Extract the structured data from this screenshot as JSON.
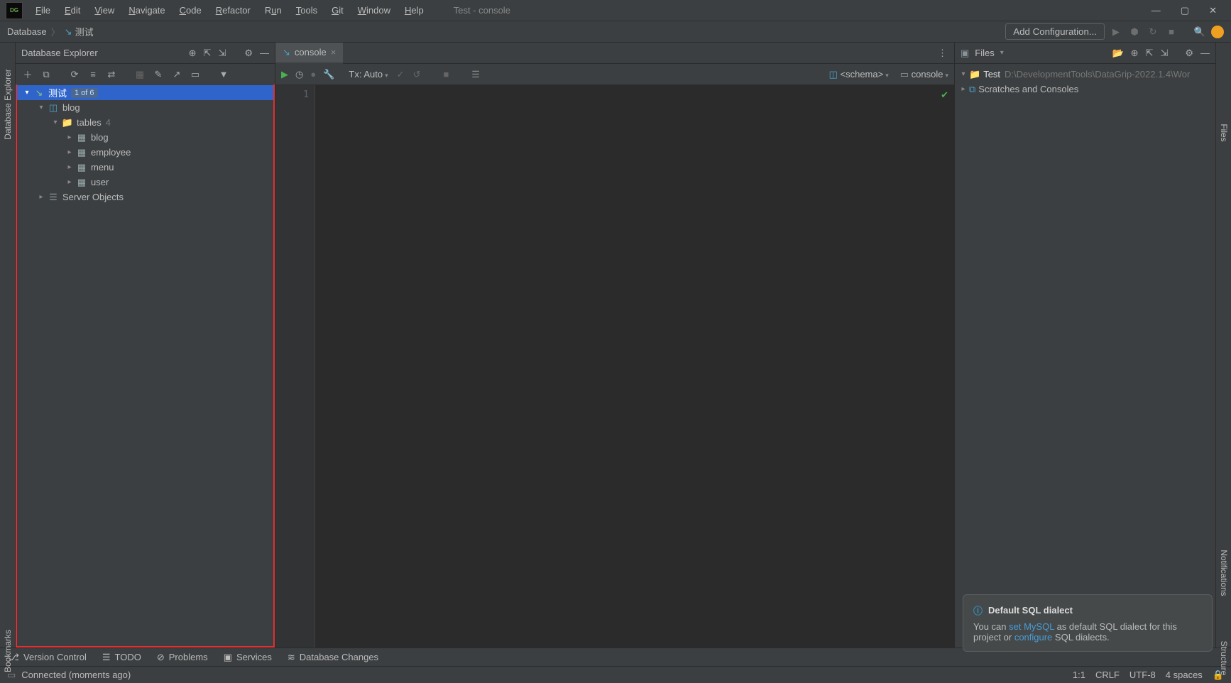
{
  "window": {
    "title": "Test - console",
    "menus": [
      "File",
      "Edit",
      "View",
      "Navigate",
      "Code",
      "Refactor",
      "Run",
      "Tools",
      "Git",
      "Window",
      "Help"
    ]
  },
  "breadcrumb": {
    "root": "Database",
    "current": "测试"
  },
  "nav_right": {
    "add_config": "Add Configuration..."
  },
  "db_explorer": {
    "title": "Database Explorer",
    "connection": {
      "name": "测试",
      "badge": "1 of 6"
    },
    "schema": "blog",
    "tables_label": "tables",
    "tables_count": "4",
    "tables": [
      "blog",
      "employee",
      "menu",
      "user"
    ],
    "server_objects": "Server Objects"
  },
  "editor": {
    "tab_name": "console",
    "gutter_line": "1",
    "tx_label": "Tx: Auto",
    "schema_label": "<schema>",
    "console_label": "console"
  },
  "files_panel": {
    "title": "Files",
    "root": "Test",
    "root_path": "D:\\DevelopmentTools\\DataGrip-2022.1.4\\Wor",
    "scratches": "Scratches and Consoles"
  },
  "notification": {
    "title": "Default SQL dialect",
    "text_a": "You can ",
    "link_a": "set MySQL",
    "text_b": " as default SQL dialect for this project or ",
    "link_b": "configure",
    "text_c": " SQL dialects."
  },
  "bottom": {
    "vc": "Version Control",
    "todo": "TODO",
    "problems": "Problems",
    "services": "Services",
    "db_changes": "Database Changes"
  },
  "status": {
    "connected": "Connected (moments ago)",
    "pos": "1:1",
    "eol": "CRLF",
    "enc": "UTF-8",
    "indent": "4 spaces"
  },
  "strips": {
    "left_db": "Database Explorer",
    "left_bm": "Bookmarks",
    "right_files": "Files",
    "right_notif": "Notifications",
    "right_struct": "Structure"
  }
}
